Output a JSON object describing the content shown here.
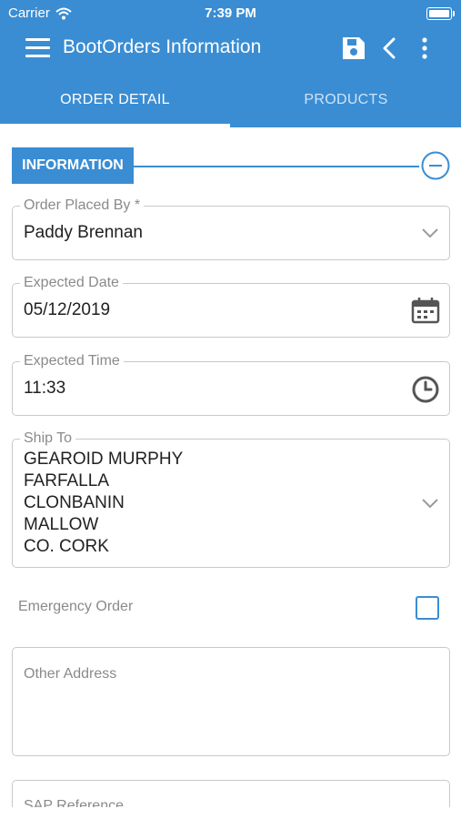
{
  "status_bar": {
    "carrier": "Carrier",
    "time": "7:39 PM"
  },
  "app_bar": {
    "title": "BootOrders Information"
  },
  "tabs": [
    {
      "label": "ORDER DETAIL",
      "active": true
    },
    {
      "label": "PRODUCTS",
      "active": false
    }
  ],
  "section": {
    "title": "INFORMATION"
  },
  "form": {
    "order_placed_by": {
      "label": "Order Placed By *",
      "value": "Paddy Brennan"
    },
    "expected_date": {
      "label": "Expected Date",
      "value": "05/12/2019"
    },
    "expected_time": {
      "label": "Expected Time",
      "value": "11:33"
    },
    "ship_to": {
      "label": "Ship To",
      "lines": [
        "GEAROID MURPHY",
        "FARFALLA",
        "CLONBANIN",
        "MALLOW",
        "CO. CORK"
      ]
    },
    "emergency_order": {
      "label": "Emergency Order",
      "checked": false
    },
    "other_address": {
      "placeholder": "Other Address",
      "value": ""
    },
    "sap_reference": {
      "label": "SAP Reference"
    }
  },
  "colors": {
    "primary": "#3a8dd3",
    "border": "#c9c9c9",
    "muted_text": "#8a8a8a"
  },
  "icons": [
    "hamburger-menu-icon",
    "save-icon",
    "back-chevron-icon",
    "more-vert-icon",
    "collapse-minus-icon",
    "chevron-down-icon",
    "calendar-icon",
    "clock-icon",
    "wifi-icon",
    "battery-icon"
  ]
}
